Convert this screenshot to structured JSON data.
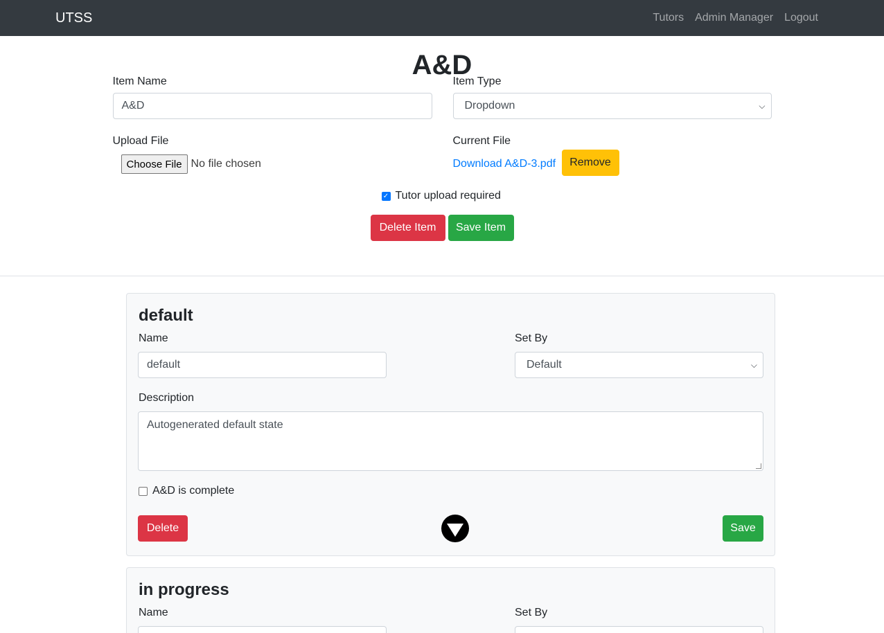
{
  "navbar": {
    "brand": "UTSS",
    "links": [
      "Tutors",
      "Admin Manager",
      "Logout"
    ]
  },
  "page": {
    "title": "A&D"
  },
  "item_form": {
    "item_name_label": "Item Name",
    "item_name_value": "A&D",
    "item_type_label": "Item Type",
    "item_type_value": "Dropdown",
    "upload_file_label": "Upload File",
    "choose_file_label": "Choose File",
    "no_file_text": "No file chosen",
    "current_file_label": "Current File",
    "download_link": "Download A&D-3.pdf",
    "remove_label": "Remove",
    "tutor_upload_label": "Tutor upload required",
    "tutor_upload_checked": true,
    "delete_item_label": "Delete Item",
    "save_item_label": "Save Item"
  },
  "states": [
    {
      "title": "default",
      "name_label": "Name",
      "name_value": "default",
      "set_by_label": "Set By",
      "set_by_value": "Default",
      "description_label": "Description",
      "description_value": "Autogenerated default state",
      "complete_label": "A&D is complete",
      "complete_checked": false,
      "delete_label": "Delete",
      "save_label": "Save"
    },
    {
      "title": "in progress",
      "name_label": "Name",
      "set_by_label": "Set By"
    }
  ],
  "colors": {
    "navbar_bg": "#343a40",
    "primary_link": "#007bff",
    "warning": "#ffc107",
    "danger": "#dc3545",
    "success": "#28a745",
    "card_bg": "#f8f9fa"
  }
}
